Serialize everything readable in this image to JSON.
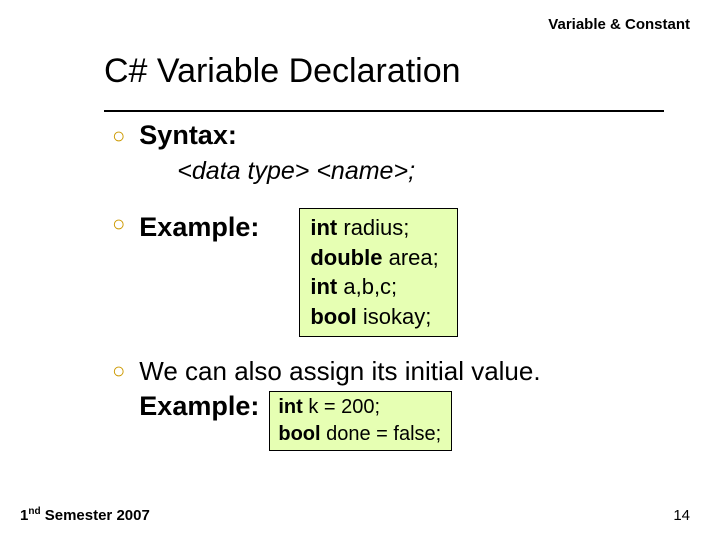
{
  "section_label": "Variable & Constant",
  "title": "C# Variable Declaration",
  "bullets": {
    "syntax": {
      "label": "Syntax:",
      "template_prefix": "<data type>",
      "template_mid": " ",
      "template_name": "<name>",
      "template_suffix": ";"
    },
    "example": {
      "label": "Example:",
      "lines": [
        {
          "kw": "int",
          "rest": " radius;"
        },
        {
          "kw": "double",
          "rest": " area;"
        },
        {
          "kw": "int",
          "rest": " a,b,c;"
        },
        {
          "kw": "bool",
          "rest": " isokay;"
        }
      ]
    },
    "assign": {
      "text": "We can also assign its initial value.",
      "example_label": "Example:",
      "lines": [
        {
          "kw": "int",
          "rest": " k = 200;"
        },
        {
          "kw": "bool",
          "rest": " done = false;"
        }
      ]
    }
  },
  "footer": {
    "left_pre": "1",
    "left_ord": "nd",
    "left_rest": " Semester 2007",
    "page": "14"
  }
}
